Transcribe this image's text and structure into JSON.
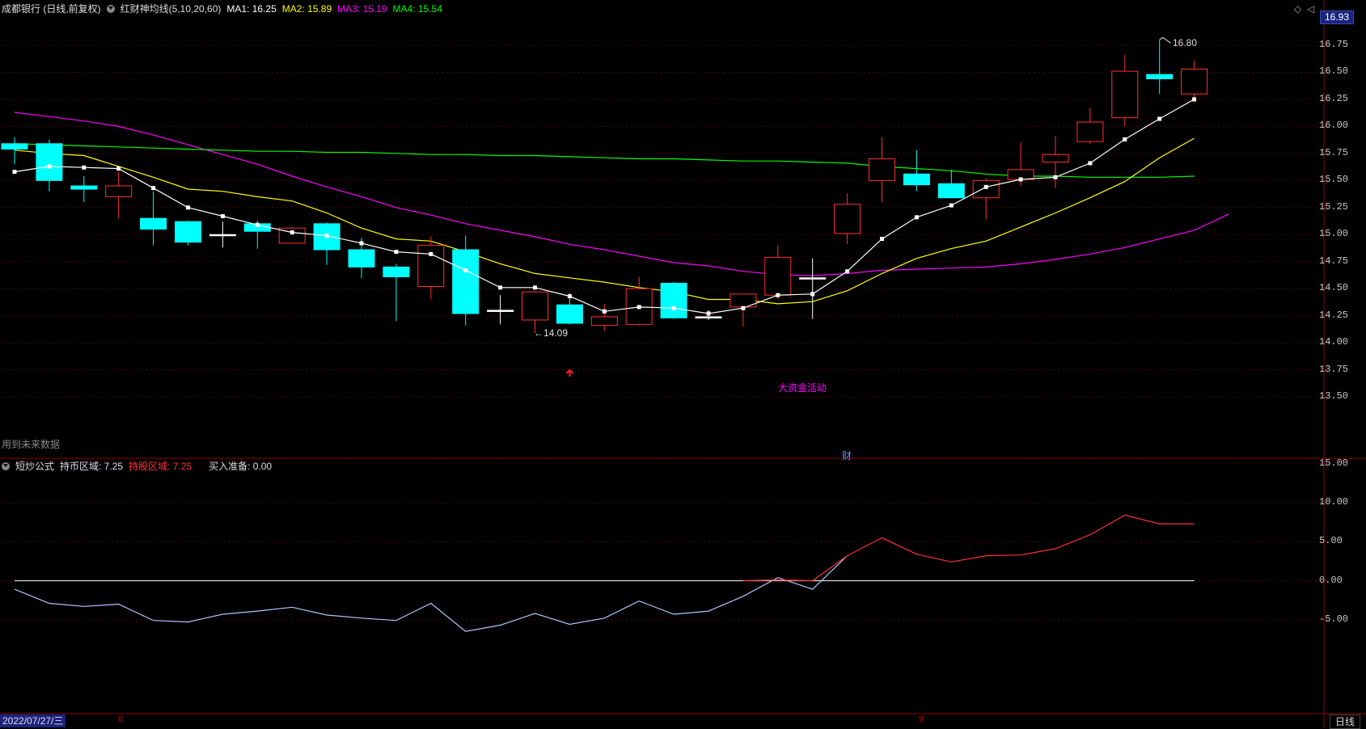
{
  "header": {
    "stock": "成都银行 (日线,前复权)",
    "indicator": "红财神均线(5,10,20,60)",
    "ma1": "MA1: 16.25",
    "ma2": "MA2: 15.89",
    "ma3": "MA3: 15.19",
    "ma4": "MA4: 15.54"
  },
  "sub_header": {
    "name": "短炒公式",
    "hold_coin": "持币区域: 7.25",
    "hold_stock": "持股区域: 7.25",
    "buy_ready": "买入准备: 0.00"
  },
  "price_box": "16.93",
  "labels": {
    "future_data": "用到未来数据",
    "big_money": "大资金活动",
    "cai": "财",
    "high_mark": "16.80",
    "low_mark": "←14.09",
    "date": "2022/07/27/三",
    "tick8": "8",
    "tick9": "9",
    "period": "日线"
  },
  "colors": {
    "up": "#ff3030",
    "down": "#00ffff",
    "ma1": "#ffffff",
    "ma2": "#ffff00",
    "ma3": "#ff00ff",
    "ma4": "#00ff00"
  },
  "chart_data": [
    {
      "type": "candlestick",
      "ylim": [
        13.3,
        16.95
      ],
      "yticks": [
        "16.75",
        "16.50",
        "16.25",
        "16.00",
        "15.75",
        "15.50",
        "15.25",
        "15.00",
        "14.75",
        "14.50",
        "14.25",
        "14.00",
        "13.75",
        "13.50"
      ],
      "candles": [
        {
          "o": 15.84,
          "h": 15.9,
          "c": 15.79,
          "l": 15.65
        },
        {
          "o": 15.84,
          "h": 15.88,
          "c": 15.5,
          "l": 15.4
        },
        {
          "o": 15.45,
          "h": 15.54,
          "c": 15.42,
          "l": 15.3
        },
        {
          "o": 15.35,
          "h": 15.58,
          "c": 15.45,
          "l": 15.15
        },
        {
          "o": 15.15,
          "h": 15.4,
          "c": 15.05,
          "l": 14.9
        },
        {
          "o": 15.12,
          "h": 15.13,
          "c": 14.93,
          "l": 14.9
        },
        {
          "o": 15.0,
          "h": 15.12,
          "c": 15.0,
          "l": 14.88
        },
        {
          "o": 15.1,
          "h": 15.13,
          "c": 15.03,
          "l": 14.87
        },
        {
          "o": 14.92,
          "h": 15.07,
          "c": 15.06,
          "l": 14.92
        },
        {
          "o": 15.1,
          "h": 15.11,
          "c": 14.86,
          "l": 14.72
        },
        {
          "o": 14.86,
          "h": 14.97,
          "c": 14.7,
          "l": 14.6
        },
        {
          "o": 14.7,
          "h": 14.73,
          "c": 14.61,
          "l": 14.2
        },
        {
          "o": 14.52,
          "h": 14.98,
          "c": 14.9,
          "l": 14.4
        },
        {
          "o": 14.86,
          "h": 14.99,
          "c": 14.27,
          "l": 14.16
        },
        {
          "o": 14.3,
          "h": 14.44,
          "c": 14.3,
          "l": 14.17
        },
        {
          "o": 14.21,
          "h": 14.48,
          "c": 14.47,
          "l": 14.09
        },
        {
          "o": 14.35,
          "h": 14.46,
          "c": 14.18,
          "l": 14.17
        },
        {
          "o": 14.16,
          "h": 14.36,
          "c": 14.24,
          "l": 14.11
        },
        {
          "o": 14.17,
          "h": 14.61,
          "c": 14.5,
          "l": 14.16
        },
        {
          "o": 14.55,
          "h": 14.56,
          "c": 14.23,
          "l": 14.22
        },
        {
          "o": 14.24,
          "h": 14.3,
          "c": 14.24,
          "l": 14.21
        },
        {
          "o": 14.33,
          "h": 14.45,
          "c": 14.45,
          "l": 14.15
        },
        {
          "o": 14.44,
          "h": 14.9,
          "c": 14.79,
          "l": 14.4
        },
        {
          "o": 14.6,
          "h": 14.78,
          "c": 14.6,
          "l": 14.22
        },
        {
          "o": 15.01,
          "h": 15.38,
          "c": 15.28,
          "l": 14.91
        },
        {
          "o": 15.5,
          "h": 15.9,
          "c": 15.7,
          "l": 15.3
        },
        {
          "o": 15.56,
          "h": 15.78,
          "c": 15.46,
          "l": 15.4
        },
        {
          "o": 15.47,
          "h": 15.6,
          "c": 15.34,
          "l": 15.34
        },
        {
          "o": 15.34,
          "h": 15.52,
          "c": 15.5,
          "l": 15.14
        },
        {
          "o": 15.51,
          "h": 15.85,
          "c": 15.6,
          "l": 15.45
        },
        {
          "o": 15.67,
          "h": 15.91,
          "c": 15.74,
          "l": 15.43
        },
        {
          "o": 15.86,
          "h": 16.17,
          "c": 16.04,
          "l": 15.84
        },
        {
          "o": 16.08,
          "h": 16.66,
          "c": 16.51,
          "l": 16.0
        },
        {
          "o": 16.48,
          "h": 16.8,
          "c": 16.44,
          "l": 16.3
        },
        {
          "o": 16.3,
          "h": 16.61,
          "c": 16.53,
          "l": 16.22
        }
      ],
      "series": [
        {
          "name": "MA1",
          "values": [
            15.58,
            15.63,
            15.62,
            15.61,
            15.43,
            15.25,
            15.17,
            15.09,
            15.02,
            14.99,
            14.92,
            14.84,
            14.82,
            14.67,
            14.51,
            14.51,
            14.43,
            14.29,
            14.33,
            14.32,
            14.27,
            14.32,
            14.44,
            14.45,
            14.66,
            14.96,
            15.16,
            15.27,
            15.44,
            15.51,
            15.53,
            15.66,
            15.88,
            16.07,
            16.25
          ]
        },
        {
          "name": "MA2",
          "values": [
            15.78,
            15.75,
            15.73,
            15.63,
            15.53,
            15.42,
            15.4,
            15.35,
            15.31,
            15.2,
            15.06,
            14.96,
            14.94,
            14.84,
            14.73,
            14.64,
            14.6,
            14.56,
            14.51,
            14.47,
            14.4,
            14.4,
            14.36,
            14.38,
            14.48,
            14.64,
            14.78,
            14.87,
            14.94,
            15.07,
            15.2,
            15.34,
            15.49,
            15.71,
            15.89
          ]
        },
        {
          "name": "MA3",
          "values": [
            16.13,
            16.09,
            16.05,
            16.0,
            15.92,
            15.83,
            15.74,
            15.65,
            15.54,
            15.44,
            15.35,
            15.25,
            15.18,
            15.1,
            15.04,
            14.98,
            14.91,
            14.86,
            14.8,
            14.74,
            14.71,
            14.66,
            14.63,
            14.62,
            14.64,
            14.67,
            14.68,
            14.69,
            14.7,
            14.73,
            14.77,
            14.82,
            14.88,
            14.96,
            15.04,
            15.19
          ]
        },
        {
          "name": "MA4",
          "values": [
            15.84,
            15.83,
            15.82,
            15.81,
            15.8,
            15.79,
            15.78,
            15.77,
            15.77,
            15.76,
            15.76,
            15.75,
            15.74,
            15.74,
            15.73,
            15.73,
            15.72,
            15.71,
            15.7,
            15.7,
            15.69,
            15.68,
            15.68,
            15.67,
            15.66,
            15.63,
            15.61,
            15.59,
            15.56,
            15.54,
            15.54,
            15.53,
            15.53,
            15.53,
            15.54
          ]
        }
      ]
    },
    {
      "type": "line",
      "ylim": [
        -8.5,
        20.5
      ],
      "yticks": [
        "15.00",
        "10.00",
        "5.00",
        "0.00",
        "-5.00"
      ],
      "series": [
        {
          "name": "持币区域",
          "values": [
            -1.1,
            -2.9,
            -3.3,
            -3.0,
            -5.1,
            -5.3,
            -4.3,
            -3.9,
            -3.4,
            -4.4,
            -4.8,
            -5.1,
            -2.9,
            -6.5,
            -5.7,
            -4.2,
            -5.6,
            -4.8,
            -2.6,
            -4.3,
            -3.9,
            -2.0,
            0.4,
            -1.1,
            3.2
          ]
        },
        {
          "name": "持股区域",
          "values": [
            null,
            null,
            null,
            null,
            null,
            null,
            null,
            null,
            null,
            null,
            null,
            null,
            null,
            null,
            null,
            null,
            null,
            null,
            null,
            null,
            null,
            0.0,
            0.1,
            0.0,
            3.2,
            5.5,
            3.4,
            2.4,
            3.2,
            3.3,
            4.1,
            5.9,
            8.4,
            7.3,
            7.3
          ]
        },
        {
          "name": "买入准备",
          "values": [
            0,
            0,
            0,
            0,
            0,
            0,
            0,
            0,
            0,
            0,
            0,
            0,
            0,
            0,
            0,
            0,
            0,
            0,
            0,
            0,
            0,
            0,
            0,
            0,
            0,
            0,
            0,
            0,
            0,
            0,
            0,
            0,
            0,
            0,
            0
          ]
        }
      ]
    }
  ]
}
